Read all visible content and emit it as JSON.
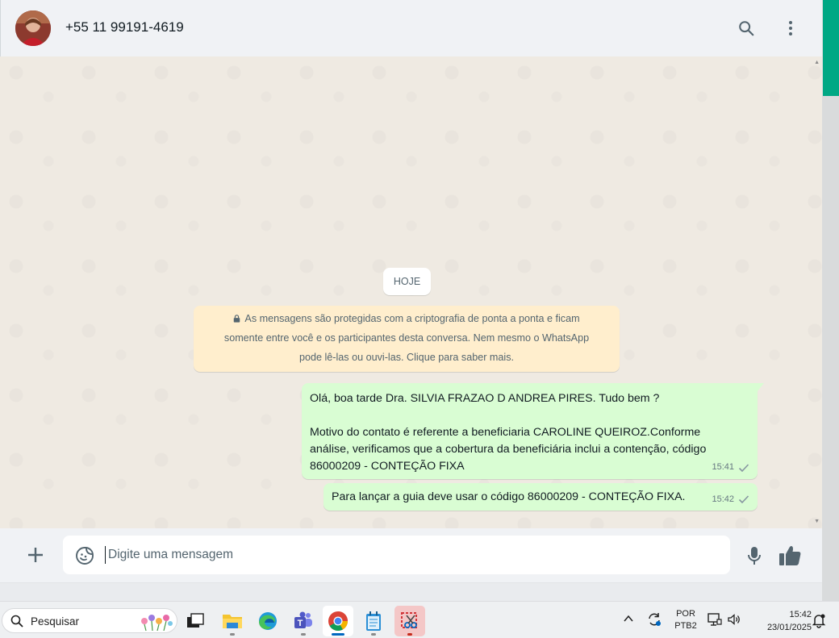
{
  "chat": {
    "contact": {
      "name": "+55 11 99191-4619"
    },
    "header_icons": [
      "search-icon",
      "menu-icon"
    ],
    "date_label": "HOJE",
    "encryption_notice": {
      "line1": "As mensagens são protegidas com a criptografia de ponta a ponta e ficam",
      "line2": "somente entre você e os participantes desta conversa. Nem mesmo o WhatsApp",
      "line3": "pode lê-las ou ouvi-las. Clique para saber mais."
    },
    "messages": [
      {
        "direction": "outgoing",
        "lines": [
          "Olá, boa tarde Dra. SILVIA FRAZAO D ANDREA PIRES. Tudo bem ?",
          "",
          "Motivo do contato é referente a beneficiaria CAROLINE QUEIROZ.Conforme",
          "análise, verificamos que a cobertura da beneficiária inclui a contenção, código",
          "86000209 - CONTEÇÃO FIXA"
        ],
        "time": "15:41",
        "status": "sent"
      },
      {
        "direction": "outgoing",
        "lines": [
          "Para lançar a guia deve usar o código 86000209 - CONTEÇÃO FIXA."
        ],
        "time": "15:42",
        "status": "sent"
      }
    ],
    "composer": {
      "placeholder": "Digite uma mensagem",
      "value": ""
    }
  },
  "taskbar": {
    "search_label": "Pesquisar",
    "apps": [
      "task-view",
      "file-explorer",
      "edge",
      "teams",
      "chrome",
      "notepad",
      "snipping-tool"
    ],
    "active_app": "chrome",
    "language": {
      "line1": "POR",
      "line2": "PTB2"
    },
    "clock": {
      "time": "15:42",
      "date": "23/01/2025"
    }
  },
  "colors": {
    "outgoing_bubble": "#d9fdd3",
    "chat_background": "#efeae2",
    "header_background": "#f0f2f5",
    "encryption_notice": "#ffeecd",
    "accent_green": "#00a884"
  }
}
